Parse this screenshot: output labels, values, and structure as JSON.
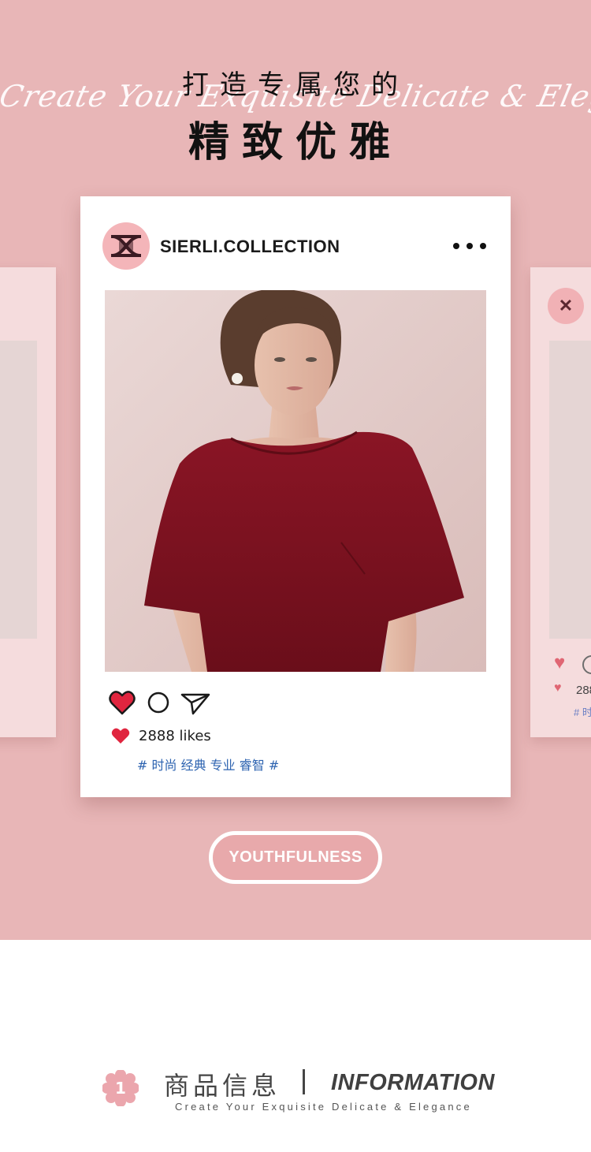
{
  "colors": {
    "hero_background": "#e8b6b7",
    "card_background": "#ffffff",
    "accent_pink": "#f4b5b9",
    "heart_red": "#e0253f",
    "hashtag_blue": "#2d63b0",
    "dress_red": "#7d1320"
  },
  "hero": {
    "title_line1": "打造专属您的",
    "title_line2": "精致优雅",
    "script_text": "Create Your Exquisite Delicate & Elegance"
  },
  "post": {
    "account_name": "SIERLI.COLLECTION",
    "avatar_icon": "brand-monogram-icon",
    "more_icon": "more-dots-icon",
    "image_alt": "model in red short-sleeve dress",
    "actions": {
      "like_icon": "heart-icon",
      "comment_icon": "comment-circle-icon",
      "share_icon": "send-icon"
    },
    "likes_text": "2888 likes",
    "hashtags": "# 时尚 经典 专业 睿智 #"
  },
  "side_card_right": {
    "likes_text_partial": "288",
    "hashtag_partial": "# 时"
  },
  "pill_button": {
    "label": "YOUTHFULNESS"
  },
  "section_header": {
    "badge_number": "1",
    "title_cn": "商品信息",
    "title_en": "INFORMATION",
    "subtitle": "Create Your Exquisite Delicate & Elegance"
  }
}
